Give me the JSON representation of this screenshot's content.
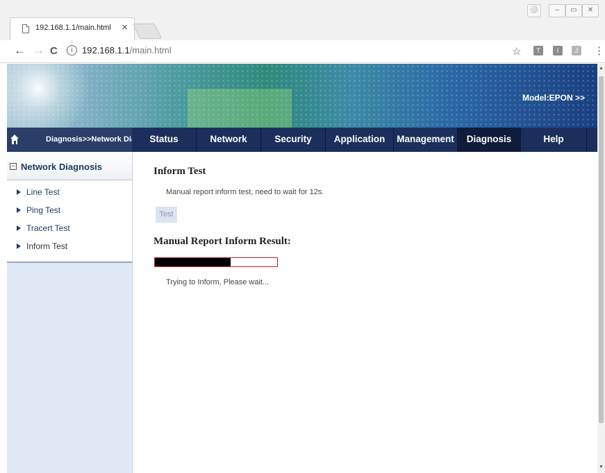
{
  "browser": {
    "tab_title": "192.168.1.1/main.html",
    "tab_close": "×",
    "address_host": "192.168.1.1",
    "address_path": "/main.html",
    "info_glyph": "ⓘ",
    "back_glyph": "←",
    "forward_glyph": "→",
    "reload_glyph": "C",
    "star_glyph": "☆",
    "menu_glyph": "⋮",
    "window_controls": [
      "‒",
      "▭",
      "✕"
    ]
  },
  "header": {
    "model": "Model:EPON >>",
    "breadcrumb": "Diagnosis>>Network Diagnosis"
  },
  "menu": {
    "items": [
      "Status",
      "Network",
      "Security",
      "Application",
      "Management",
      "Diagnosis",
      "Help"
    ],
    "active": "Diagnosis"
  },
  "sidebar": {
    "section_title": "Network Diagnosis",
    "items": [
      "Line Test",
      "Ping Test",
      "Tracert Test",
      "Inform Test"
    ]
  },
  "main": {
    "title": "Inform Test",
    "description": "Manual report inform test, need to wait for 12s.",
    "test_button": "Test",
    "result_title": "Manual Report Inform Result:",
    "progress_fraction": 0.62,
    "status_text": "Trying to Inform, Please wait..."
  },
  "colors": {
    "nav_bg": "#1c2f5c",
    "nav_active": "#101c3c",
    "sidebar_bg": "#dfe9f5",
    "progress_border": "#c0232c",
    "progress_fill": "#000000"
  },
  "icons": [
    "document-icon",
    "info-icon",
    "home-icon",
    "minus-box-icon",
    "arrow-right-icon",
    "star-icon"
  ]
}
